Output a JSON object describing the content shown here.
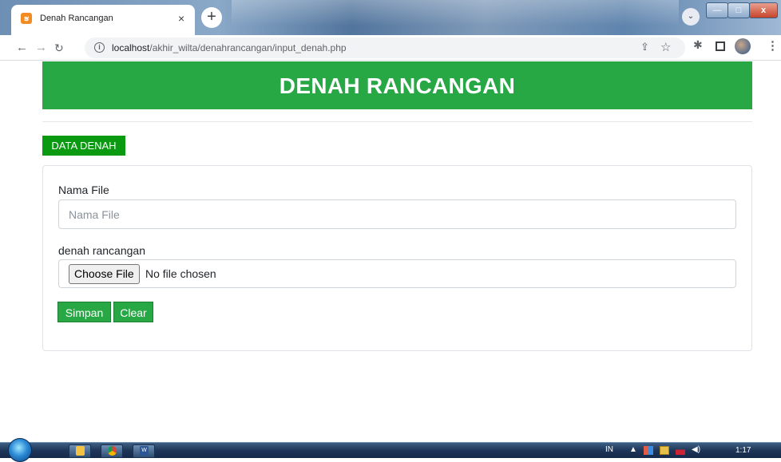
{
  "browser": {
    "tab_title": "Denah Rancangan",
    "tab_close": "×",
    "new_tab": "+",
    "url_host": "localhost",
    "url_path": "/akhir_wilta/denahrancangan/input_denah.php"
  },
  "page": {
    "header_title": "DENAH RANCANGAN",
    "data_denah_button": "DATA DENAH",
    "form": {
      "nama_label": "Nama File",
      "nama_placeholder": "Nama File",
      "nama_value": "",
      "denah_label": "denah rancangan",
      "choose_file_label": "Choose File",
      "no_file_text": "No file chosen",
      "simpan_label": "Simpan",
      "clear_label": "Clear"
    }
  },
  "taskbar": {
    "language": "IN",
    "clock": "1:17"
  },
  "colors": {
    "primary_green": "#28a745",
    "data_button_green": "#0a9a12",
    "favicon_orange": "#f28b23"
  },
  "icons": {
    "back": "back-arrow-icon",
    "forward": "forward-arrow-icon",
    "reload": "reload-icon",
    "info": "info-icon",
    "share": "share-icon",
    "bookmark": "star-icon",
    "extensions": "puzzle-icon",
    "side_panel": "side-panel-icon",
    "profile": "avatar",
    "menu": "kebab-menu-icon"
  }
}
